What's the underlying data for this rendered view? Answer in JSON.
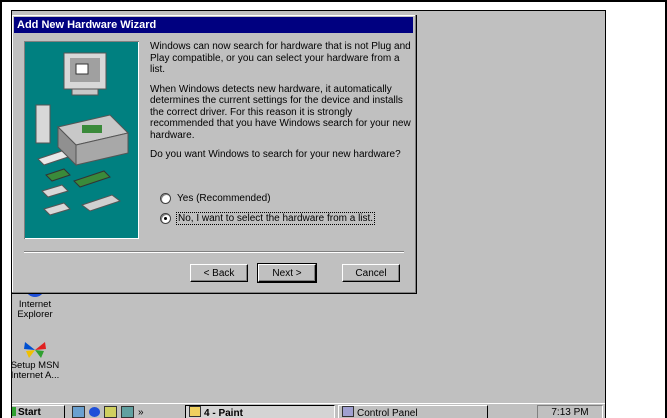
{
  "dialog": {
    "title": "Add New Hardware Wizard",
    "para1": "Windows can now search for hardware that is not Plug and Play compatible, or you can select your hardware from a list.",
    "para2": "When Windows detects new hardware, it automatically determines the current settings for the device and installs the correct driver. For this reason it is strongly recommended that you have Windows search for your new hardware.",
    "question": "Do you want Windows to search for your new hardware?",
    "options": [
      {
        "label": "Yes (Recommended)",
        "selected": false
      },
      {
        "label": "No, I want to select the hardware from a list.",
        "selected": true
      }
    ],
    "buttons": {
      "back": "< Back",
      "next": "Next >",
      "cancel": "Cancel"
    }
  },
  "desktop_icons": [
    {
      "label_line1": "Internet",
      "label_line2": "Explorer",
      "icon": "internet-explorer-icon"
    },
    {
      "label_line1": "Setup MSN",
      "label_line2": "Internet A...",
      "icon": "msn-butterfly-icon"
    }
  ],
  "taskbar": {
    "start_label": "Start",
    "quicklaunch_overflow": "»",
    "tasks": [
      {
        "label": "4 - Paint",
        "icon": "paint-icon"
      },
      {
        "label": "Control Panel",
        "icon": "control-panel-icon"
      }
    ],
    "clock": "7:13 PM"
  },
  "colors": {
    "title_bar": "#000080",
    "desktop": "#c0c0c0",
    "art_bg": "#008080"
  }
}
